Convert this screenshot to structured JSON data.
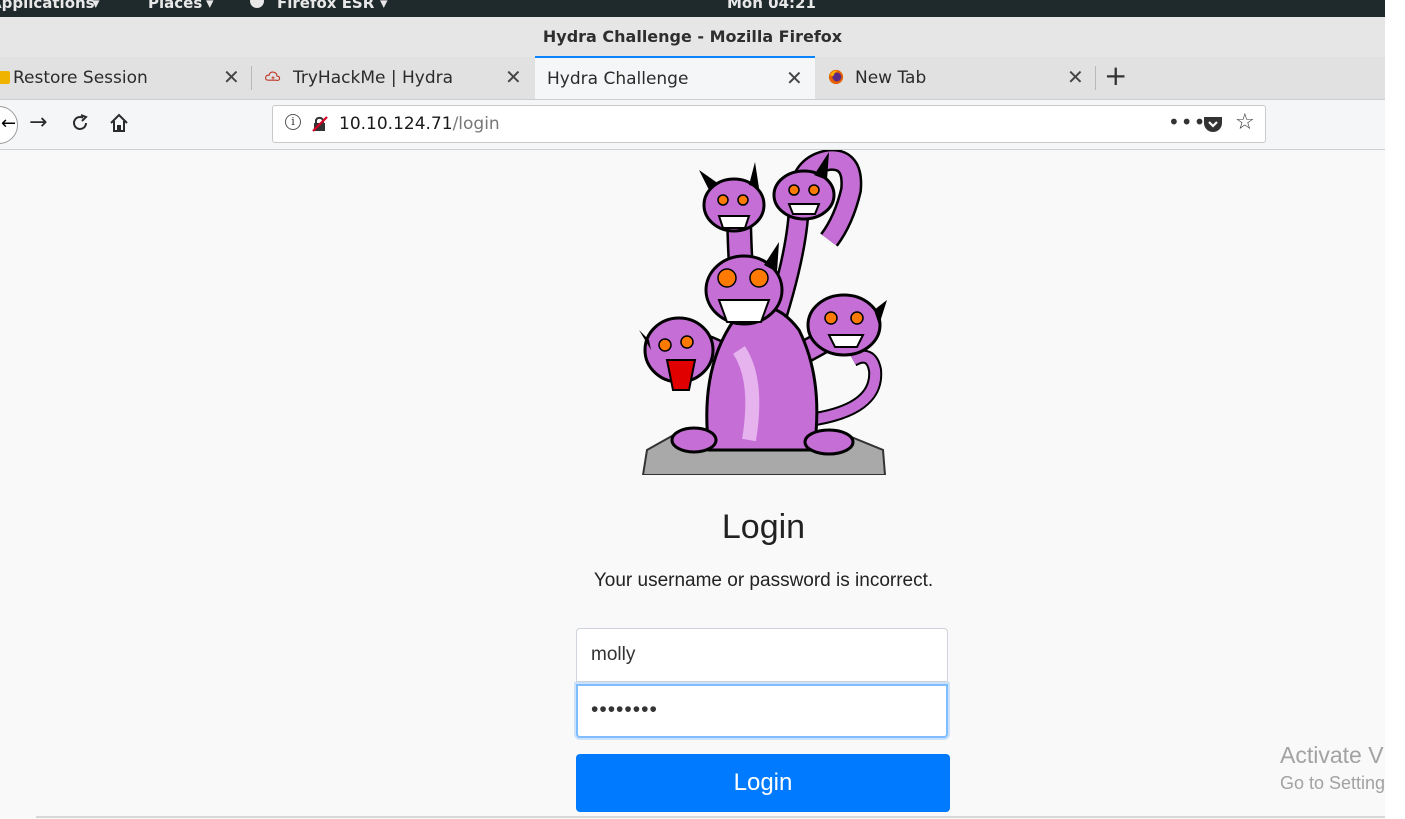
{
  "desktop": {
    "applications": "Applications",
    "places": "Places",
    "app_name": "Firefox ESR",
    "clock": "Mon 04:21"
  },
  "window": {
    "title": "Hydra Challenge - Mozilla Firefox"
  },
  "tabs": [
    {
      "label": "Restore Session"
    },
    {
      "label": "TryHackMe | Hydra"
    },
    {
      "label": "Hydra Challenge"
    },
    {
      "label": "New Tab"
    }
  ],
  "url": {
    "host": "10.10.124.71",
    "path": "/login"
  },
  "page": {
    "heading": "Login",
    "message": "Your username or password is incorrect.",
    "username_value": "molly",
    "password_mask": "••••••••",
    "login_button": "Login"
  },
  "watermark": {
    "line1": "Activate V",
    "line2": "Go to Setting"
  },
  "colors": {
    "accent": "#007bff",
    "tab_highlight": "#0a84ff"
  }
}
